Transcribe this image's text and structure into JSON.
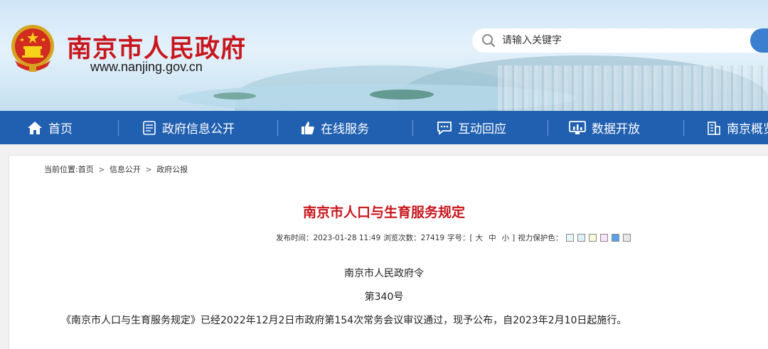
{
  "header": {
    "site_title": "南京市人民政府",
    "site_url": "www.nanjing.gov.cn",
    "search_placeholder": "请输入关键字"
  },
  "nav": {
    "items": [
      {
        "label": "首页",
        "icon": "home-icon"
      },
      {
        "label": "政府信息公开",
        "icon": "document-icon"
      },
      {
        "label": "在线服务",
        "icon": "thumbs-up-icon"
      },
      {
        "label": "互动回应",
        "icon": "chat-icon"
      },
      {
        "label": "数据开放",
        "icon": "monitor-chart-icon"
      },
      {
        "label": "南京概览",
        "icon": "building-icon"
      }
    ]
  },
  "breadcrumb": {
    "prefix": "当前位置:",
    "items": [
      "首页",
      "信息公开",
      "政府公报"
    ],
    "separator": ">"
  },
  "article": {
    "title": "南京市人口与生育服务规定",
    "meta": {
      "publish_label": "发布时间：",
      "publish_time": "2023-01-28 11:49",
      "views_label": "浏览次数：",
      "views": "27419",
      "font_label": "字号：",
      "bracket_open": "[",
      "font_large": "大",
      "font_medium": "中",
      "font_small": "小",
      "bracket_close": "]",
      "eye_label": "视力保护色："
    },
    "eye_colors": [
      "#e6f7fb",
      "#dff3f7",
      "#fbf8dc",
      "#fbe3fa",
      "#5aa0e6",
      "#e7e7e7"
    ],
    "order_title": "南京市人民政府令",
    "order_number": "第340号",
    "body": "《南京市人口与生育服务规定》已经2022年12月2日市政府第154次常务会议审议通过，现予公布，自2023年2月10日起施行。"
  },
  "colors": {
    "brand_red": "#c8161d",
    "nav_blue": "#2160b0"
  }
}
